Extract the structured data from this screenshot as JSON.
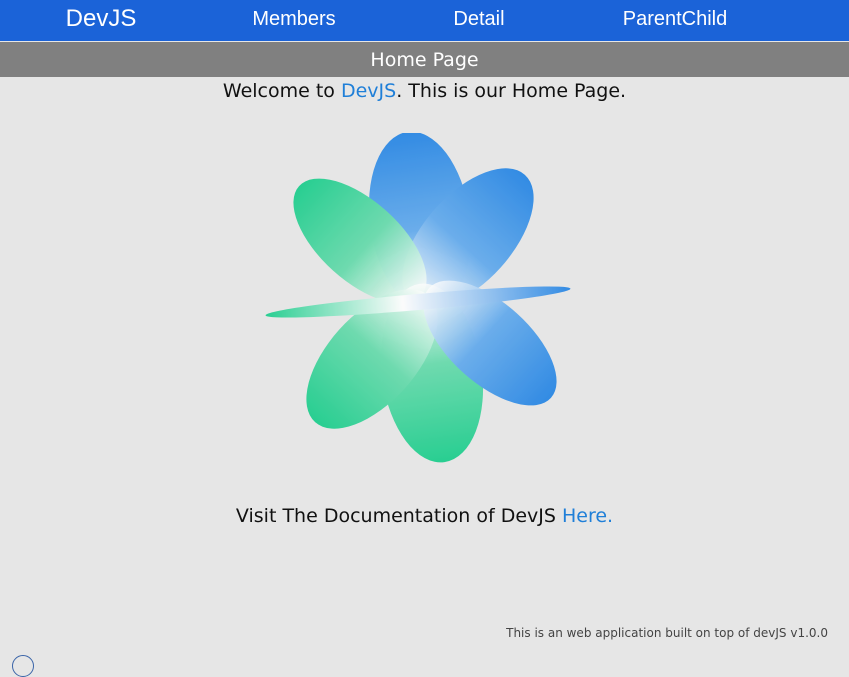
{
  "nav": {
    "brand": "DevJS",
    "items": [
      "Members",
      "Detail",
      "ParentChild"
    ]
  },
  "page_title": "Home Page",
  "welcome": {
    "prefix": "Welcome to ",
    "brand_link": "DevJS",
    "suffix": ". This is our Home Page."
  },
  "docs": {
    "text": "Visit The Documentation of DevJS ",
    "link": "Here."
  },
  "footer": "This is an web application built on top of devJS v1.0.0",
  "colors": {
    "navbar": "#1b63d8",
    "subbar": "#808080",
    "background": "#e6e6e6",
    "accent": "#1f7fd8",
    "logo_blue": "#1a7fe3",
    "logo_green": "#10cc86"
  }
}
